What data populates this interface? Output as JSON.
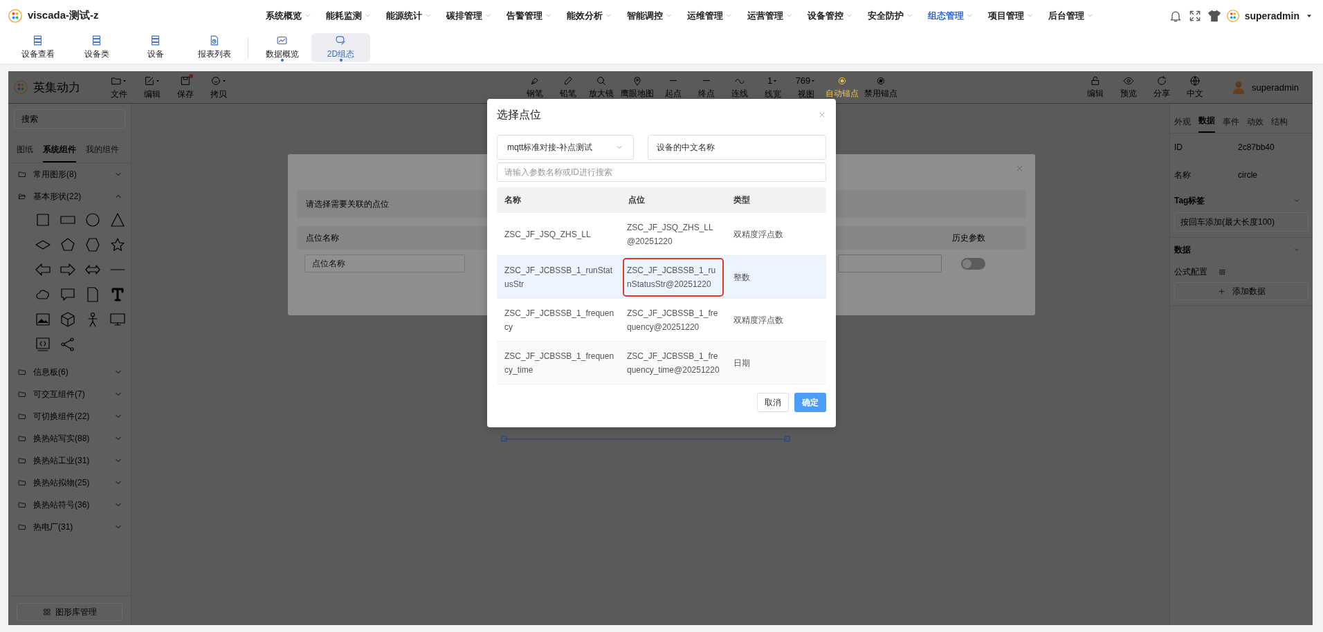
{
  "app": {
    "title": "viscada-测试-z"
  },
  "main_menu": [
    {
      "label": "系统概览",
      "selected": false
    },
    {
      "label": "能耗监测",
      "selected": false
    },
    {
      "label": "能源统计",
      "selected": false
    },
    {
      "label": "碳排管理",
      "selected": false
    },
    {
      "label": "告警管理",
      "selected": false
    },
    {
      "label": "能效分析",
      "selected": false
    },
    {
      "label": "智能调控",
      "selected": false
    },
    {
      "label": "运维管理",
      "selected": false
    },
    {
      "label": "运营管理",
      "selected": false
    },
    {
      "label": "设备管控",
      "selected": false
    },
    {
      "label": "安全防护",
      "selected": false
    },
    {
      "label": "组态管理",
      "selected": true
    },
    {
      "label": "项目管理",
      "selected": false
    },
    {
      "label": "后台管理",
      "selected": false
    }
  ],
  "header_user": {
    "name": "superadmin"
  },
  "quick_bar": {
    "tools": [
      {
        "label": "设备查看"
      },
      {
        "label": "设备类"
      },
      {
        "label": "设备"
      },
      {
        "label": "报表列表"
      }
    ],
    "pages": [
      {
        "label": "数据概览",
        "selected": false,
        "open": true
      },
      {
        "label": "2D组态",
        "selected": true,
        "open": true
      }
    ]
  },
  "editor": {
    "brand": "英集动力",
    "file_menu": [
      {
        "label": "文件",
        "dropdown": true,
        "dot": false
      },
      {
        "label": "编辑",
        "dropdown": true,
        "dot": false
      },
      {
        "label": "保存",
        "dropdown": false,
        "dot": true
      },
      {
        "label": "拷贝",
        "dropdown": true,
        "dot": false
      }
    ],
    "tools": [
      {
        "kind": "icon",
        "label": "钢笔",
        "active": false
      },
      {
        "kind": "icon",
        "label": "铅笔",
        "active": false
      },
      {
        "kind": "icon",
        "label": "放大镜",
        "active": false
      },
      {
        "kind": "icon",
        "label": "鹰眼地图",
        "active": false
      },
      {
        "kind": "icon",
        "label": "起点",
        "active": false
      },
      {
        "kind": "icon",
        "label": "终点",
        "active": false
      },
      {
        "kind": "icon",
        "label": "连线",
        "active": false
      },
      {
        "kind": "value",
        "value": "1",
        "label": "线宽",
        "active": false
      },
      {
        "kind": "value",
        "value": "769",
        "label": "视图",
        "active": false
      },
      {
        "kind": "icon",
        "label": "自动锚点",
        "active": true
      },
      {
        "kind": "icon",
        "label": "禁用锚点",
        "active": false
      }
    ],
    "right_tools": [
      {
        "label": "编辑"
      },
      {
        "label": "预览"
      },
      {
        "label": "分享"
      },
      {
        "label": "中文"
      }
    ],
    "user": {
      "name": "superadmin"
    }
  },
  "left_panel": {
    "search": {
      "placeholder": "搜索"
    },
    "tabs": [
      {
        "label": "图纸",
        "selected": false
      },
      {
        "label": "系统组件",
        "selected": true
      },
      {
        "label": "我的组件",
        "selected": false
      }
    ],
    "categories": [
      {
        "name": "常用图形(8)",
        "expanded": false
      },
      {
        "name": "基本形状(22)",
        "expanded": true
      },
      {
        "name": "信息板(6)",
        "expanded": false
      },
      {
        "name": "可交互组件(7)",
        "expanded": false
      },
      {
        "name": "可切换组件(22)",
        "expanded": false
      },
      {
        "name": "换热站写实(88)",
        "expanded": false
      },
      {
        "name": "换热站工业(31)",
        "expanded": false
      },
      {
        "name": "换热站拟物(25)",
        "expanded": false
      },
      {
        "name": "换热站符号(36)",
        "expanded": false
      },
      {
        "name": "热电厂(31)",
        "expanded": false
      }
    ],
    "footer_button": "图形库管理"
  },
  "right_panel": {
    "tabs": [
      {
        "label": "外观",
        "selected": false
      },
      {
        "label": "数据",
        "selected": true
      },
      {
        "label": "事件",
        "selected": false
      },
      {
        "label": "动效",
        "selected": false
      },
      {
        "label": "结构",
        "selected": false
      }
    ],
    "fields": [
      {
        "label": "ID",
        "value": "2c87bb40"
      },
      {
        "label": "名称",
        "value": "circle"
      }
    ],
    "tag_section": {
      "title": "Tag标签",
      "placeholder": "按回车添加(最大长度100)"
    },
    "data_section": {
      "title": "数据",
      "formula_label": "公式配置",
      "add_button": "添加数据"
    }
  },
  "back_dialog": {
    "hint": "请选择需要关联的点位",
    "columns": [
      "点位名称",
      "历史参数"
    ],
    "name_input": {
      "placeholder": "点位名称"
    },
    "history_toggle": {
      "on": false
    }
  },
  "modal": {
    "title": "选择点位",
    "device_select": {
      "value": "mqtt标准对接-补点测试"
    },
    "name_field": {
      "value": "设备的中文名称"
    },
    "search": {
      "placeholder": "请输入参数名称或ID进行搜索"
    },
    "table": {
      "columns": [
        "名称",
        "点位",
        "类型"
      ],
      "rows": [
        {
          "name": "ZSC_JF_JSQ_ZHS_LL",
          "point": "ZSC_JF_JSQ_ZHS_LL@20251220",
          "type": "双精度浮点数",
          "selected": false,
          "outlined": false
        },
        {
          "name": "ZSC_JF_JCBSSB_1_runStatusStr",
          "point": "ZSC_JF_JCBSSB_1_runStatusStr@20251220",
          "type": "整数",
          "selected": true,
          "outlined": true
        },
        {
          "name": "ZSC_JF_JCBSSB_1_frequency",
          "point": "ZSC_JF_JCBSSB_1_frequency@20251220",
          "type": "双精度浮点数",
          "selected": false,
          "outlined": false
        },
        {
          "name": "ZSC_JF_JCBSSB_1_frequency_time",
          "point": "ZSC_JF_JCBSSB_1_frequency_time@20251220",
          "type": "日期",
          "selected": false,
          "outlined": false
        }
      ]
    },
    "buttons": {
      "cancel": "取消",
      "confirm": "确定"
    }
  }
}
